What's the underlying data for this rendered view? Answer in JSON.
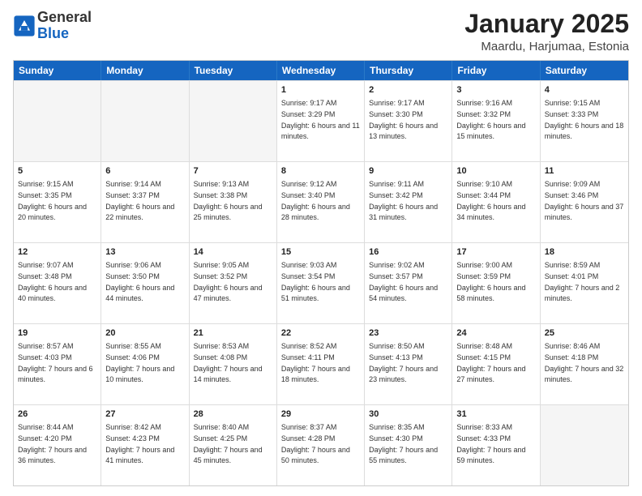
{
  "header": {
    "logo_general": "General",
    "logo_blue": "Blue",
    "month_title": "January 2025",
    "location": "Maardu, Harjumaa, Estonia"
  },
  "weekdays": [
    "Sunday",
    "Monday",
    "Tuesday",
    "Wednesday",
    "Thursday",
    "Friday",
    "Saturday"
  ],
  "rows": [
    [
      {
        "day": "",
        "empty": true
      },
      {
        "day": "",
        "empty": true
      },
      {
        "day": "",
        "empty": true
      },
      {
        "day": "1",
        "sunrise": "9:17 AM",
        "sunset": "3:29 PM",
        "daylight": "6 hours and 11 minutes."
      },
      {
        "day": "2",
        "sunrise": "9:17 AM",
        "sunset": "3:30 PM",
        "daylight": "6 hours and 13 minutes."
      },
      {
        "day": "3",
        "sunrise": "9:16 AM",
        "sunset": "3:32 PM",
        "daylight": "6 hours and 15 minutes."
      },
      {
        "day": "4",
        "sunrise": "9:15 AM",
        "sunset": "3:33 PM",
        "daylight": "6 hours and 18 minutes."
      }
    ],
    [
      {
        "day": "5",
        "sunrise": "9:15 AM",
        "sunset": "3:35 PM",
        "daylight": "6 hours and 20 minutes."
      },
      {
        "day": "6",
        "sunrise": "9:14 AM",
        "sunset": "3:37 PM",
        "daylight": "6 hours and 22 minutes."
      },
      {
        "day": "7",
        "sunrise": "9:13 AM",
        "sunset": "3:38 PM",
        "daylight": "6 hours and 25 minutes."
      },
      {
        "day": "8",
        "sunrise": "9:12 AM",
        "sunset": "3:40 PM",
        "daylight": "6 hours and 28 minutes."
      },
      {
        "day": "9",
        "sunrise": "9:11 AM",
        "sunset": "3:42 PM",
        "daylight": "6 hours and 31 minutes."
      },
      {
        "day": "10",
        "sunrise": "9:10 AM",
        "sunset": "3:44 PM",
        "daylight": "6 hours and 34 minutes."
      },
      {
        "day": "11",
        "sunrise": "9:09 AM",
        "sunset": "3:46 PM",
        "daylight": "6 hours and 37 minutes."
      }
    ],
    [
      {
        "day": "12",
        "sunrise": "9:07 AM",
        "sunset": "3:48 PM",
        "daylight": "6 hours and 40 minutes."
      },
      {
        "day": "13",
        "sunrise": "9:06 AM",
        "sunset": "3:50 PM",
        "daylight": "6 hours and 44 minutes."
      },
      {
        "day": "14",
        "sunrise": "9:05 AM",
        "sunset": "3:52 PM",
        "daylight": "6 hours and 47 minutes."
      },
      {
        "day": "15",
        "sunrise": "9:03 AM",
        "sunset": "3:54 PM",
        "daylight": "6 hours and 51 minutes."
      },
      {
        "day": "16",
        "sunrise": "9:02 AM",
        "sunset": "3:57 PM",
        "daylight": "6 hours and 54 minutes."
      },
      {
        "day": "17",
        "sunrise": "9:00 AM",
        "sunset": "3:59 PM",
        "daylight": "6 hours and 58 minutes."
      },
      {
        "day": "18",
        "sunrise": "8:59 AM",
        "sunset": "4:01 PM",
        "daylight": "7 hours and 2 minutes."
      }
    ],
    [
      {
        "day": "19",
        "sunrise": "8:57 AM",
        "sunset": "4:03 PM",
        "daylight": "7 hours and 6 minutes."
      },
      {
        "day": "20",
        "sunrise": "8:55 AM",
        "sunset": "4:06 PM",
        "daylight": "7 hours and 10 minutes."
      },
      {
        "day": "21",
        "sunrise": "8:53 AM",
        "sunset": "4:08 PM",
        "daylight": "7 hours and 14 minutes."
      },
      {
        "day": "22",
        "sunrise": "8:52 AM",
        "sunset": "4:11 PM",
        "daylight": "7 hours and 18 minutes."
      },
      {
        "day": "23",
        "sunrise": "8:50 AM",
        "sunset": "4:13 PM",
        "daylight": "7 hours and 23 minutes."
      },
      {
        "day": "24",
        "sunrise": "8:48 AM",
        "sunset": "4:15 PM",
        "daylight": "7 hours and 27 minutes."
      },
      {
        "day": "25",
        "sunrise": "8:46 AM",
        "sunset": "4:18 PM",
        "daylight": "7 hours and 32 minutes."
      }
    ],
    [
      {
        "day": "26",
        "sunrise": "8:44 AM",
        "sunset": "4:20 PM",
        "daylight": "7 hours and 36 minutes."
      },
      {
        "day": "27",
        "sunrise": "8:42 AM",
        "sunset": "4:23 PM",
        "daylight": "7 hours and 41 minutes."
      },
      {
        "day": "28",
        "sunrise": "8:40 AM",
        "sunset": "4:25 PM",
        "daylight": "7 hours and 45 minutes."
      },
      {
        "day": "29",
        "sunrise": "8:37 AM",
        "sunset": "4:28 PM",
        "daylight": "7 hours and 50 minutes."
      },
      {
        "day": "30",
        "sunrise": "8:35 AM",
        "sunset": "4:30 PM",
        "daylight": "7 hours and 55 minutes."
      },
      {
        "day": "31",
        "sunrise": "8:33 AM",
        "sunset": "4:33 PM",
        "daylight": "7 hours and 59 minutes."
      },
      {
        "day": "",
        "empty": true
      }
    ]
  ]
}
